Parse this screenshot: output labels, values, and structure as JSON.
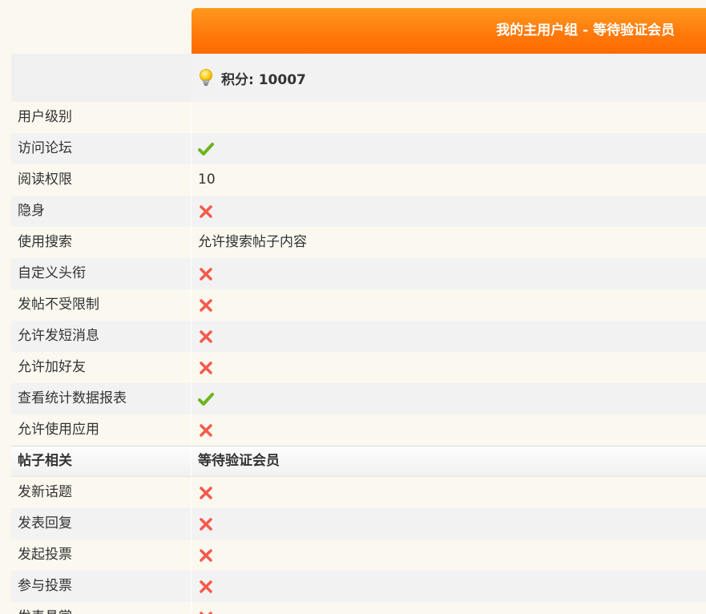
{
  "group_header": {
    "title": "我的主用户组 - 等待验证会员"
  },
  "credits": {
    "icon": "lightbulb-icon",
    "text": "积分: 10007"
  },
  "colors": {
    "header_orange_top": "#ff9a1e",
    "header_orange_bottom": "#ff6a00",
    "check_green": "#6cb51e",
    "cross_red": "#f45a4a"
  },
  "rows": [
    {
      "label": "用户级别",
      "value_type": "text",
      "value": ""
    },
    {
      "label": "访问论坛",
      "value_type": "icon",
      "icon": "check-icon"
    },
    {
      "label": "阅读权限",
      "value_type": "text",
      "value": "10"
    },
    {
      "label": "隐身",
      "value_type": "icon",
      "icon": "cross-icon"
    },
    {
      "label": "使用搜索",
      "value_type": "text",
      "value": "允许搜索帖子内容"
    },
    {
      "label": "自定义头衔",
      "value_type": "icon",
      "icon": "cross-icon"
    },
    {
      "label": "发帖不受限制",
      "value_type": "icon",
      "icon": "cross-icon"
    },
    {
      "label": "允许发短消息",
      "value_type": "icon",
      "icon": "cross-icon"
    },
    {
      "label": "允许加好友",
      "value_type": "icon",
      "icon": "cross-icon"
    },
    {
      "label": "查看统计数据报表",
      "value_type": "icon",
      "icon": "check-icon"
    },
    {
      "label": "允许使用应用",
      "value_type": "icon",
      "icon": "cross-icon"
    }
  ],
  "section": {
    "label": "帖子相关",
    "value": "等待验证会员"
  },
  "post_rows": [
    {
      "label": "发新话题",
      "value_type": "icon",
      "icon": "cross-icon"
    },
    {
      "label": "发表回复",
      "value_type": "icon",
      "icon": "cross-icon"
    },
    {
      "label": "发起投票",
      "value_type": "icon",
      "icon": "cross-icon"
    },
    {
      "label": "参与投票",
      "value_type": "icon",
      "icon": "cross-icon"
    },
    {
      "label": "发表悬赏",
      "value_type": "icon",
      "icon": "cross-icon"
    }
  ]
}
